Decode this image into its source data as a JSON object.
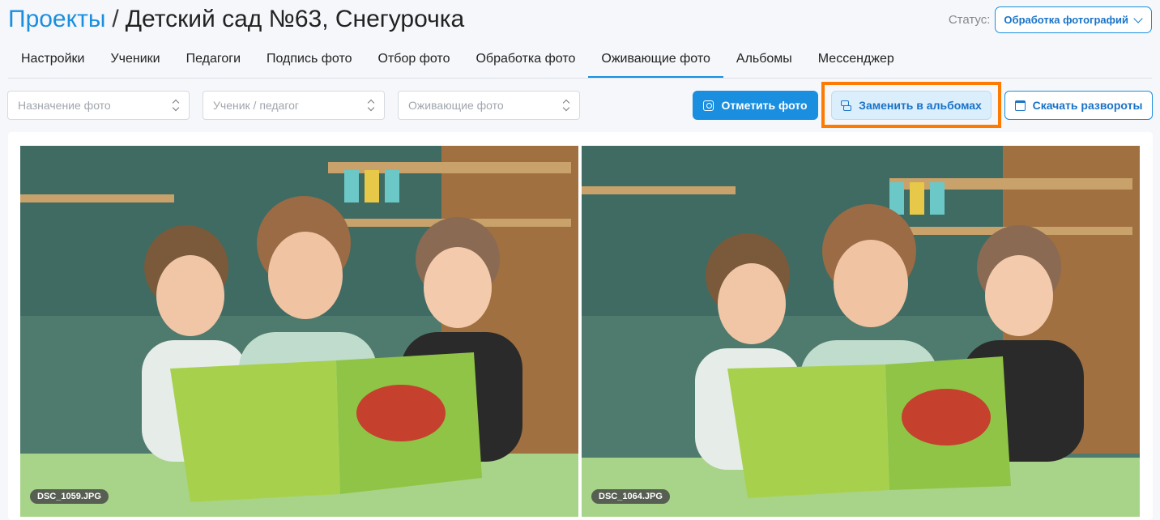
{
  "header": {
    "breadcrumb_root": "Проекты",
    "separator": "/",
    "project_name": "Детский сад №63, Снегурочка",
    "status_label": "Статус:",
    "status_value": "Обработка фотографий"
  },
  "tabs": [
    {
      "label": "Настройки",
      "active": false
    },
    {
      "label": "Ученики",
      "active": false
    },
    {
      "label": "Педагоги",
      "active": false
    },
    {
      "label": "Подпись фото",
      "active": false
    },
    {
      "label": "Отбор фото",
      "active": false
    },
    {
      "label": "Обработка фото",
      "active": false
    },
    {
      "label": "Оживающие фото",
      "active": true
    },
    {
      "label": "Альбомы",
      "active": false
    },
    {
      "label": "Мессенджер",
      "active": false
    }
  ],
  "filters": {
    "purpose_placeholder": "Назначение фото",
    "person_placeholder": "Ученик / педагог",
    "live_placeholder": "Оживающие фото"
  },
  "actions": {
    "mark_photo": "Отметить фото",
    "replace_in_albums": "Заменить в альбомах",
    "download_spreads": "Скачать развороты"
  },
  "photos": [
    {
      "filename": "DSC_1059.JPG"
    },
    {
      "filename": "DSC_1064.JPG"
    }
  ],
  "colors": {
    "accent": "#1a8fe0",
    "highlight": "#ff7a00"
  }
}
